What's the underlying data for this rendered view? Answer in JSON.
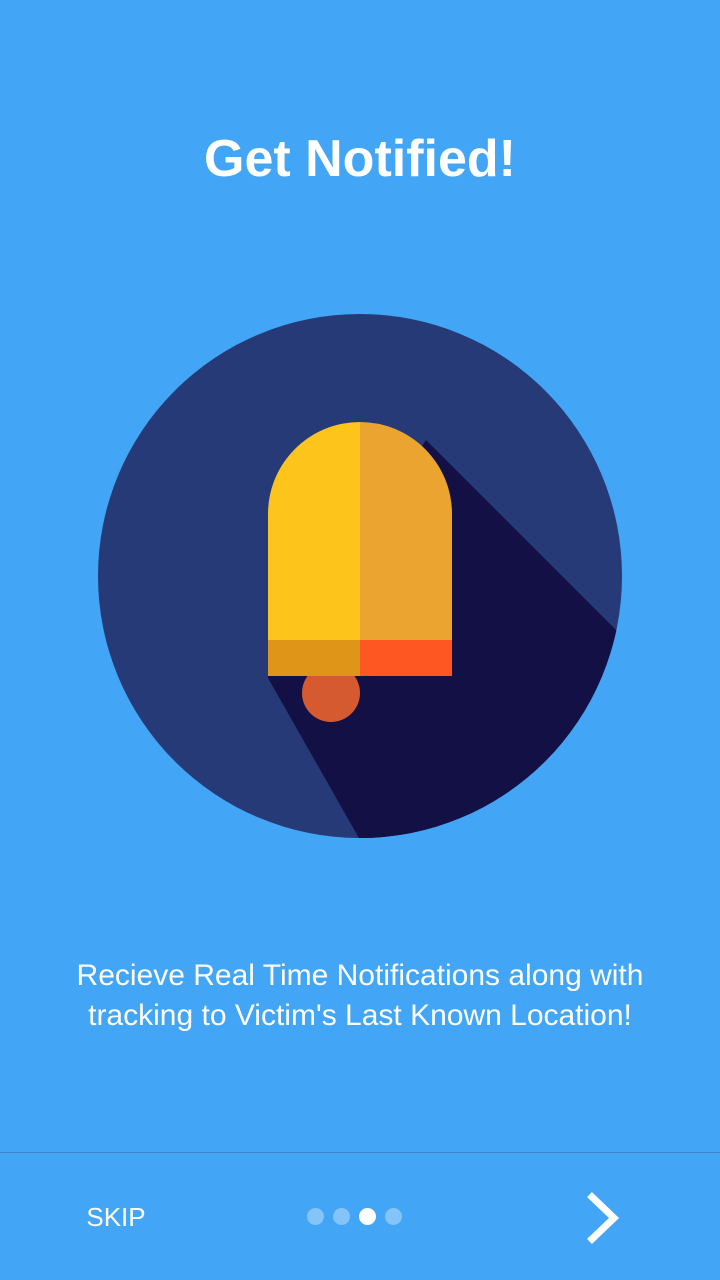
{
  "onboarding": {
    "title": "Get Notified!",
    "description": "Recieve Real Time Notifications along with tracking to Victim's Last Known Location!",
    "illustration_icon": "bell-icon"
  },
  "navigation": {
    "skip_label": "SKIP",
    "next_icon": "chevron-right-icon",
    "page_count": 4,
    "current_page": 3
  },
  "colors": {
    "background": "#42a5f5",
    "circle": "#263a78",
    "shadow": "#121045",
    "bell_light": "#fdc41c",
    "bell_dark": "#eaa42f",
    "rim_light": "#df9618",
    "rim_dark": "#ff5722",
    "clapper": "#d65a30"
  }
}
